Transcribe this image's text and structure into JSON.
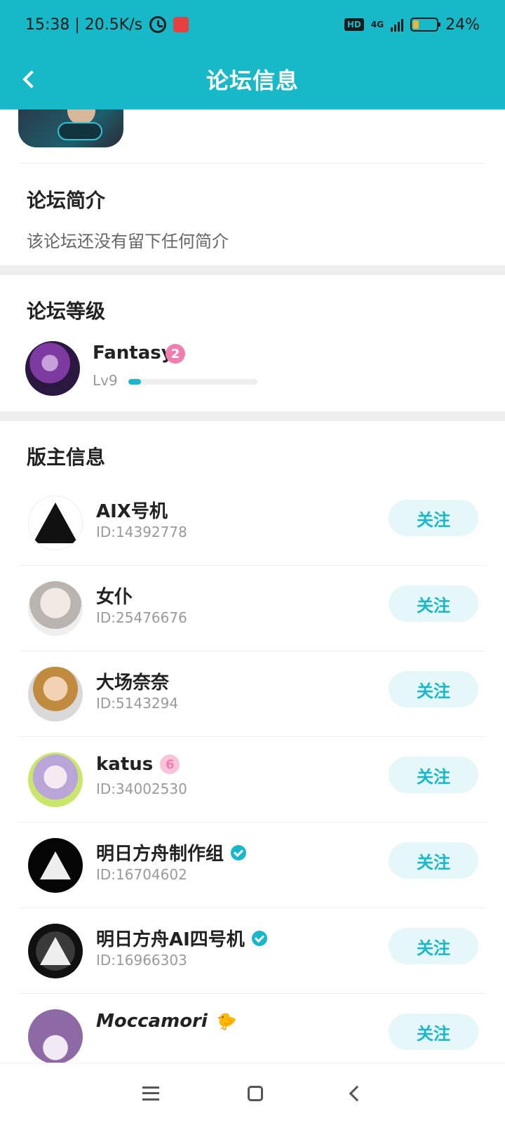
{
  "status_bar": {
    "time_speed": "15:38 | 20.5K/s",
    "hd_label": "HD",
    "network": "4G",
    "battery_text": "24%",
    "battery_level": 0.24
  },
  "header": {
    "title": "论坛信息"
  },
  "intro": {
    "title": "论坛简介",
    "text": "该论坛还没有留下任何简介"
  },
  "level": {
    "title": "论坛等级",
    "name": "Fantasy",
    "badge": "2",
    "lv": "Lv9",
    "progress": 0.1
  },
  "moderators": {
    "title": "版主信息",
    "follow_label": "关注",
    "items": [
      {
        "name": "AIX号机",
        "id": "ID:14392778"
      },
      {
        "name": "女仆",
        "id": "ID:25476676"
      },
      {
        "name": "大场奈奈",
        "id": "ID:5143294"
      },
      {
        "name": "katus",
        "id": "ID:34002530",
        "badge": "6"
      },
      {
        "name": "明日方舟制作组",
        "id": "ID:16704602"
      },
      {
        "name": "明日方舟AI四号机",
        "id": "ID:16966303"
      },
      {
        "name": "Moccamori",
        "id": ""
      }
    ]
  },
  "colors": {
    "accent": "#17b8c7",
    "badge_pink": "#f07eb1"
  },
  "icons": {
    "back": "chevron-left-icon",
    "verified": "verified-check-icon"
  }
}
